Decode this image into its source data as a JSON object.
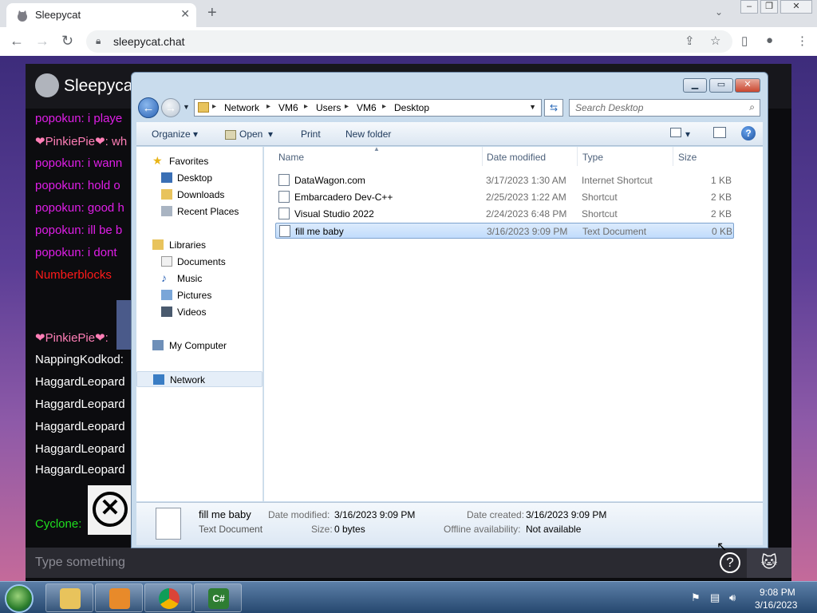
{
  "browser": {
    "tab_title": "Sleepycat",
    "new_tab": "+",
    "close_tab": "✕",
    "url": "sleepycat.chat"
  },
  "chat": {
    "brand": "Sleepycat",
    "messages": [
      {
        "user": "popokun:",
        "text": " i playe",
        "color": "#e01ee8"
      },
      {
        "user": "❤PinkiePie❤:",
        "text": " wh",
        "color": "#ff7eb6"
      },
      {
        "user": "popokun:",
        "text": " i wann",
        "color": "#e01ee8"
      },
      {
        "user": "popokun:",
        "text": " hold o",
        "color": "#e01ee8"
      },
      {
        "user": "popokun:",
        "text": " good h",
        "color": "#e01ee8"
      },
      {
        "user": "popokun:",
        "text": " ill be b",
        "color": "#e01ee8"
      },
      {
        "user": "popokun:",
        "text": " i dont",
        "color": "#e01ee8"
      },
      {
        "user": "Numberblocks",
        "text": "",
        "color": "#ff1a1a"
      },
      {
        "user": "❤PinkiePie❤:",
        "text": "",
        "color": "#ff7eb6"
      },
      {
        "user": "NappingKodkod:",
        "text": "",
        "color": "#ffffff"
      },
      {
        "user": "HaggardLeopard",
        "text": "",
        "color": "#ffffff"
      },
      {
        "user": "HaggardLeopard",
        "text": "",
        "color": "#ffffff"
      },
      {
        "user": "HaggardLeopard",
        "text": "",
        "color": "#ffffff"
      },
      {
        "user": "HaggardLeopard",
        "text": "",
        "color": "#ffffff"
      },
      {
        "user": "HaggardLeopard",
        "text": "",
        "color": "#ffffff"
      },
      {
        "user": "Cyclone:",
        "text": "",
        "color": "#1fe01f"
      }
    ],
    "input_placeholder": "Type something",
    "help_label": "?"
  },
  "explorer": {
    "breadcrumb": [
      "Network",
      "VM6",
      "Users",
      "VM6",
      "Desktop"
    ],
    "search_placeholder": "Search Desktop",
    "commands": {
      "organize": "Organize",
      "open": "Open",
      "print": "Print",
      "new_folder": "New folder"
    },
    "nav": {
      "favorites": "Favorites",
      "desktop": "Desktop",
      "downloads": "Downloads",
      "recent": "Recent Places",
      "libraries": "Libraries",
      "documents": "Documents",
      "music": "Music",
      "pictures": "Pictures",
      "videos": "Videos",
      "computer": "My Computer",
      "network": "Network"
    },
    "columns": {
      "name": "Name",
      "date": "Date modified",
      "type": "Type",
      "size": "Size"
    },
    "files": [
      {
        "name": "DataWagon.com",
        "date": "3/17/2023 1:30 AM",
        "type": "Internet Shortcut",
        "size": "1 KB"
      },
      {
        "name": "Embarcadero Dev-C++",
        "date": "2/25/2023 1:22 AM",
        "type": "Shortcut",
        "size": "2 KB"
      },
      {
        "name": "Visual Studio 2022",
        "date": "2/24/2023 6:48 PM",
        "type": "Shortcut",
        "size": "2 KB"
      },
      {
        "name": "fill me baby",
        "date": "3/16/2023 9:09 PM",
        "type": "Text Document",
        "size": "0 KB"
      }
    ],
    "details": {
      "name": "fill me baby",
      "type": "Text Document",
      "date_modified_label": "Date modified:",
      "date_modified": "3/16/2023 9:09 PM",
      "size_label": "Size:",
      "size": "0 bytes",
      "date_created_label": "Date created:",
      "date_created": "3/16/2023 9:09 PM",
      "offline_label": "Offline availability:",
      "offline": "Not available"
    }
  },
  "taskbar": {
    "time": "9:08 PM",
    "date": "3/16/2023",
    "csharp_label": "C#"
  }
}
